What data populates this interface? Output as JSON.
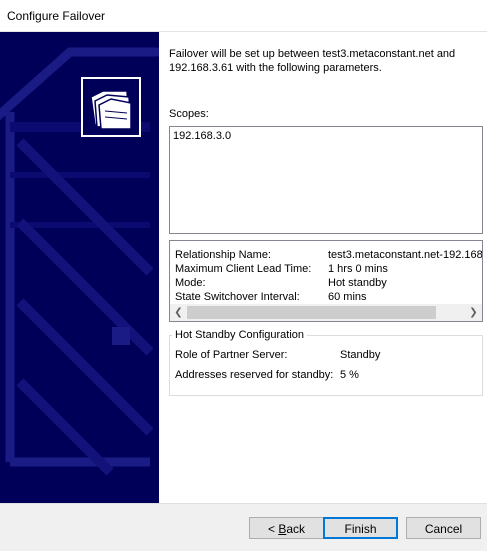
{
  "window": {
    "title": "Configure Failover"
  },
  "intro_text": "Failover will be set up between test3.metaconstant.net and 192.168.3.61 with the following parameters.",
  "scopes": {
    "label": "Scopes:",
    "items": [
      "192.168.3.0"
    ]
  },
  "parameters": [
    {
      "label": "Relationship Name:",
      "value": "test3.metaconstant.net-192.168."
    },
    {
      "label": "Maximum Client Lead Time:",
      "value": "1 hrs 0 mins"
    },
    {
      "label": "Mode:",
      "value": "Hot standby"
    },
    {
      "label": "State Switchover Interval:",
      "value": "60 mins"
    }
  ],
  "hot_standby": {
    "title": "Hot Standby Configuration",
    "rows": [
      {
        "label": "Role of Partner Server:",
        "value": "Standby"
      },
      {
        "label": "Addresses reserved for standby:",
        "value": "5 %"
      }
    ]
  },
  "buttons": {
    "back_accel": "B",
    "back_rest": "ack",
    "back_prefix": "< ",
    "finish": "Finish",
    "cancel": "Cancel"
  },
  "icons": {
    "wizard": "folders-icon",
    "scroll_left": "chevron-left-icon",
    "scroll_right": "chevron-right-icon"
  },
  "colors": {
    "banner": "#000059",
    "accent": "#0078d7"
  }
}
